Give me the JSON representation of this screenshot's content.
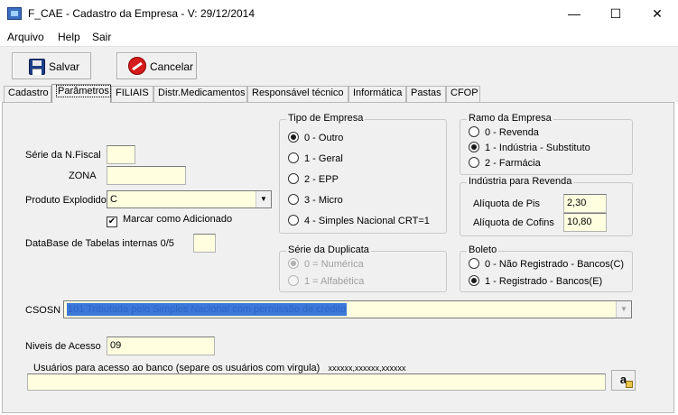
{
  "window": {
    "title": "F_CAE - Cadastro da Empresa - V: 29/12/2014",
    "minimize": "—",
    "maximize": "☐",
    "close": "✕"
  },
  "menu": {
    "arquivo": "Arquivo",
    "help": "Help",
    "sair": "Sair"
  },
  "toolbar": {
    "save_label": "Salvar",
    "cancel_label": "Cancelar"
  },
  "tabs": [
    {
      "label": "Cadastro"
    },
    {
      "label": "Parâmetros"
    },
    {
      "label": "FILIAIS"
    },
    {
      "label": "Distr.Medicamentos"
    },
    {
      "label": "Responsável técnico"
    },
    {
      "label": "Informática"
    },
    {
      "label": "Pastas"
    },
    {
      "label": "CFOP"
    }
  ],
  "form": {
    "serie_nf_label": "Série da N.Fiscal",
    "serie_nf_value": "",
    "zona_label": "ZONA",
    "zona_value": "",
    "produto_explodido_label": "Produto Explodido",
    "produto_explodido_value": "C",
    "marcar_adicionado_label": "Marcar como Adicionado",
    "marcar_adicionado_checked": true,
    "database_label": "DataBase de Tabelas internas 0/5",
    "database_value": "",
    "csosn_label": "CSOSN",
    "csosn_value": "101 Tributada pelo Simples Nacional com permissão de crédito",
    "niveis_label": "Niveis de Acesso",
    "niveis_value": "09",
    "usuarios_label": "Usuários para acesso ao banco (separe os usuários com virgula)",
    "usuarios_example": "xxxxxx,xxxxxx,xxxxxx",
    "usuarios_value": ""
  },
  "tipo_empresa": {
    "title": "Tipo de Empresa",
    "options": [
      "0 - Outro",
      "1 - Geral",
      "2 - EPP",
      "3 - Micro",
      "4 - Simples Nacional CRT=1"
    ],
    "selected": 0
  },
  "serie_duplicata": {
    "title": "Série da Duplicata",
    "options": [
      "0 = Numérica",
      "1 = Alfabética"
    ],
    "selected": 0,
    "enabled": false
  },
  "ramo_empresa": {
    "title": "Ramo da Empresa",
    "options": [
      "0 - Revenda",
      "1 - Indústria - Substituto",
      "2 - Farmácia"
    ],
    "selected": 1
  },
  "industria_revenda": {
    "title": "Indústria para Revenda",
    "pis_label": "Alíquota de Pis",
    "pis_value": "2,30",
    "cofins_label": "Alíquota de Cofins",
    "cofins_value": "10,80"
  },
  "boleto": {
    "title": "Boleto",
    "options": [
      "0 - Não Registrado - Bancos(C)",
      "1 - Registrado - Bancos(E)"
    ],
    "selected": 1
  },
  "icons": {
    "app": "app-icon",
    "save": "floppy-disk-icon",
    "cancel": "no-entry-icon",
    "dropdown": "chevron-down-icon",
    "search_button": "a-pencil-icon"
  },
  "search_button_glyph": "a"
}
